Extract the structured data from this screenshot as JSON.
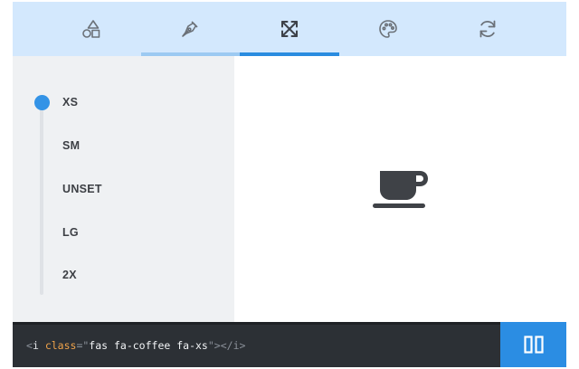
{
  "tabs": [
    {
      "icon": "shapes-icon",
      "state": "default"
    },
    {
      "icon": "pen-nib-icon",
      "state": "hover"
    },
    {
      "icon": "expand-arrows-icon",
      "state": "active"
    },
    {
      "icon": "palette-icon",
      "state": "default"
    },
    {
      "icon": "sync-icon",
      "state": "default"
    }
  ],
  "sizes": {
    "selected": "XS",
    "items": [
      "XS",
      "SM",
      "UNSET",
      "LG",
      "2X"
    ]
  },
  "preview": {
    "icon": "coffee-icon",
    "color": "#3f4247"
  },
  "code": {
    "open_bracket": "<",
    "tag": "i",
    "attr": "class",
    "eq_quote": "=\"",
    "value": "fas fa-coffee fa-xs",
    "close_quote": "\"",
    "gt": ">",
    "close_tag": "</i>"
  },
  "copy_button": {
    "icon": "copy-icon"
  },
  "colors": {
    "accent": "#2b8de3",
    "tab_bar": "#d3e8fd",
    "sidebar": "#eff1f3",
    "code_bg": "#2c3035"
  }
}
